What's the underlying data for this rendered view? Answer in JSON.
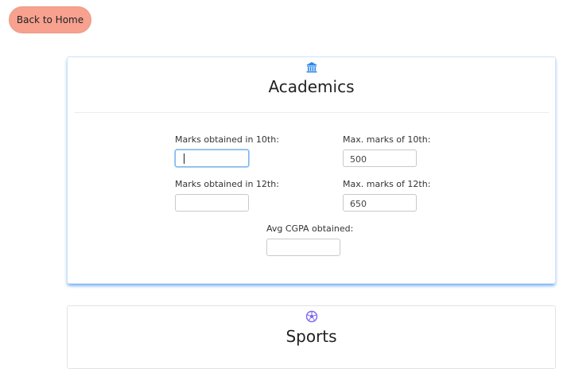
{
  "back_button": {
    "label": "Back to Home"
  },
  "academics": {
    "icon": "institution-icon",
    "title": "Academics",
    "fields": {
      "marks10": {
        "label": "Marks obtained in 10th:",
        "value": ""
      },
      "max10": {
        "label": "Max. marks of 10th:",
        "value": "500"
      },
      "marks12": {
        "label": "Marks obtained in 12th:",
        "value": ""
      },
      "max12": {
        "label": "Max. marks of 12th:",
        "value": "650"
      },
      "cgpa": {
        "label": "Avg CGPA obtained:",
        "value": ""
      }
    }
  },
  "sports": {
    "icon": "soccer-ball-icon",
    "title": "Sports"
  },
  "colors": {
    "back_button_bg": "#f7a18e",
    "academics_icon": "#2a86e8",
    "sports_icon": "#7b68ee",
    "focus_border": "#7fb6ee"
  }
}
